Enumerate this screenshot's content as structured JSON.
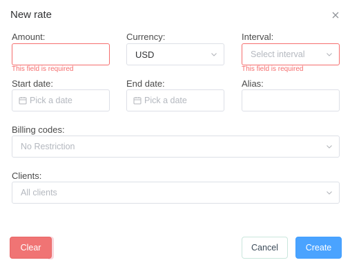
{
  "dialog": {
    "title": "New rate"
  },
  "fields": {
    "amount": {
      "label": "Amount:",
      "value": "",
      "error": "This field is required"
    },
    "currency": {
      "label": "Currency:",
      "value": "USD"
    },
    "interval": {
      "label": "Interval:",
      "placeholder": "Select interval",
      "error": "This field is required"
    },
    "start_date": {
      "label": "Start date:",
      "placeholder": "Pick a date"
    },
    "end_date": {
      "label": "End date:",
      "placeholder": "Pick a date"
    },
    "alias": {
      "label": "Alias:",
      "value": ""
    },
    "billing_codes": {
      "label": "Billing codes:",
      "placeholder": "No Restriction"
    },
    "clients": {
      "label": "Clients:",
      "placeholder": "All clients"
    }
  },
  "buttons": {
    "clear": "Clear",
    "cancel": "Cancel",
    "create": "Create"
  },
  "icons": {
    "close": "close-icon",
    "chevron": "chevron-down-icon",
    "calendar": "calendar-icon"
  },
  "colors": {
    "error": "#f56c6c",
    "primary": "#409eff",
    "danger": "#f07474"
  }
}
